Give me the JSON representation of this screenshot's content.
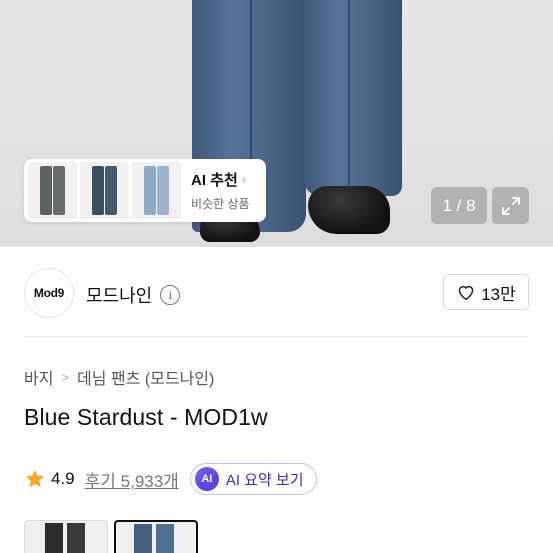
{
  "hero": {
    "ai_card": {
      "title": "AI 추천",
      "subtitle": "비슷한 상품",
      "thumbs": [
        "gray-jeans",
        "dark-blue-jeans",
        "light-blue-jeans"
      ]
    },
    "counter": "1 / 8",
    "expand_icon": "expand-icon"
  },
  "brand": {
    "logo_text": "Mod9",
    "name": "모드나인",
    "info_icon": "info-icon",
    "like_count": "13만"
  },
  "breadcrumb": [
    "바지",
    "데님 팬츠 (모드나인)"
  ],
  "product": {
    "title": "Blue Stardust - MOD1w"
  },
  "rating": {
    "value": "4.9",
    "reviews_label": "후기 5,933개",
    "ai_badge": "AI",
    "ai_summary_label": "AI 요약 보기"
  },
  "colors": {
    "accent_purple": "#4b3ad6",
    "star": "#f5a623",
    "denim": "#4a6688"
  }
}
